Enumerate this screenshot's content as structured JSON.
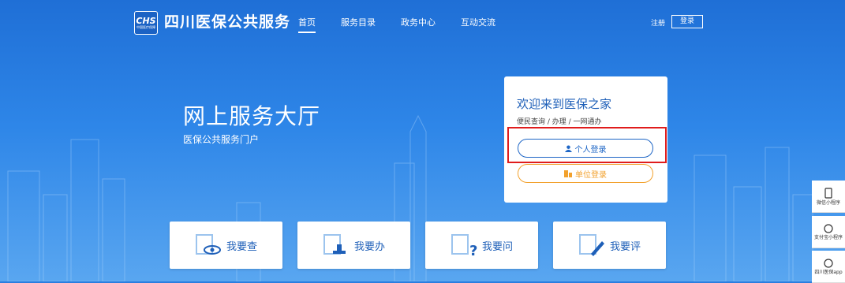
{
  "header": {
    "logo_text": "CHS",
    "logo_sub": "中国医疗保障",
    "brand": "四川医保公共服务",
    "nav": [
      "首页",
      "服务目录",
      "政务中心",
      "互动交流"
    ],
    "register": "注册",
    "login": "登录"
  },
  "hero": {
    "title": "网上服务大厅",
    "subtitle": "医保公共服务门户"
  },
  "login_card": {
    "title": "欢迎来到医保之家",
    "subtitle": "便民查询 / 办理 / 一网通办",
    "personal_login": "个人登录",
    "org_login": "单位登录"
  },
  "tiles": [
    "我要查",
    "我要办",
    "我要问",
    "我要评"
  ],
  "side_panel": [
    "微信小程序",
    "支付宝小程序",
    "四川医保app"
  ],
  "colors": {
    "accent": "#1e66c6",
    "org": "#f2a12d",
    "highlight": "#e01c1c"
  }
}
